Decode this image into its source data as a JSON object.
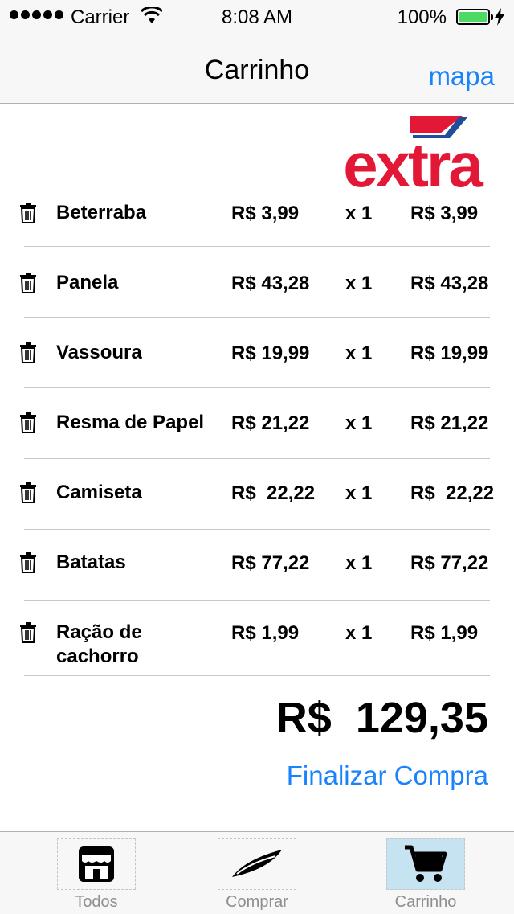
{
  "status_bar": {
    "carrier": "Carrier",
    "time": "8:08 AM",
    "battery": "100%"
  },
  "nav": {
    "title": "Carrinho",
    "right_button": "mapa"
  },
  "logo": {
    "text": "extra",
    "color": "#e31837",
    "stripe_color": "#1f4e9a"
  },
  "cart": {
    "items": [
      {
        "name": "Beterraba",
        "price": "R$ 3,99",
        "qty": "x 1",
        "subtotal": "R$ 3,99"
      },
      {
        "name": "Panela",
        "price": "R$ 43,28",
        "qty": "x 1",
        "subtotal": "R$ 43,28"
      },
      {
        "name": "Vassoura",
        "price": "R$ 19,99",
        "qty": "x 1",
        "subtotal": "R$ 19,99"
      },
      {
        "name": "Resma de Papel",
        "price": "R$ 21,22",
        "qty": "x 1",
        "subtotal": "R$ 21,22"
      },
      {
        "name": "Camiseta",
        "price": "R$  22,22",
        "qty": "x 1",
        "subtotal": "R$  22,22"
      },
      {
        "name": "Batatas",
        "price": "R$ 77,22",
        "qty": "x 1",
        "subtotal": "R$ 77,22"
      },
      {
        "name": "Ração de cachorro",
        "price": "R$ 1,99",
        "qty": "x 1",
        "subtotal": "R$ 1,99"
      }
    ],
    "total": "R$  129,35",
    "finalize_label": "Finalizar Compra"
  },
  "tabbar": {
    "tabs": [
      {
        "label": "Todos",
        "icon": "store-icon"
      },
      {
        "label": "Comprar",
        "icon": "checkout-icon"
      },
      {
        "label": "Carrinho",
        "icon": "cart-icon",
        "selected": true
      }
    ]
  },
  "colors": {
    "accent": "#1a82fb",
    "battery": "#4cd964",
    "active_tab_bg": "#c6e3f2"
  }
}
